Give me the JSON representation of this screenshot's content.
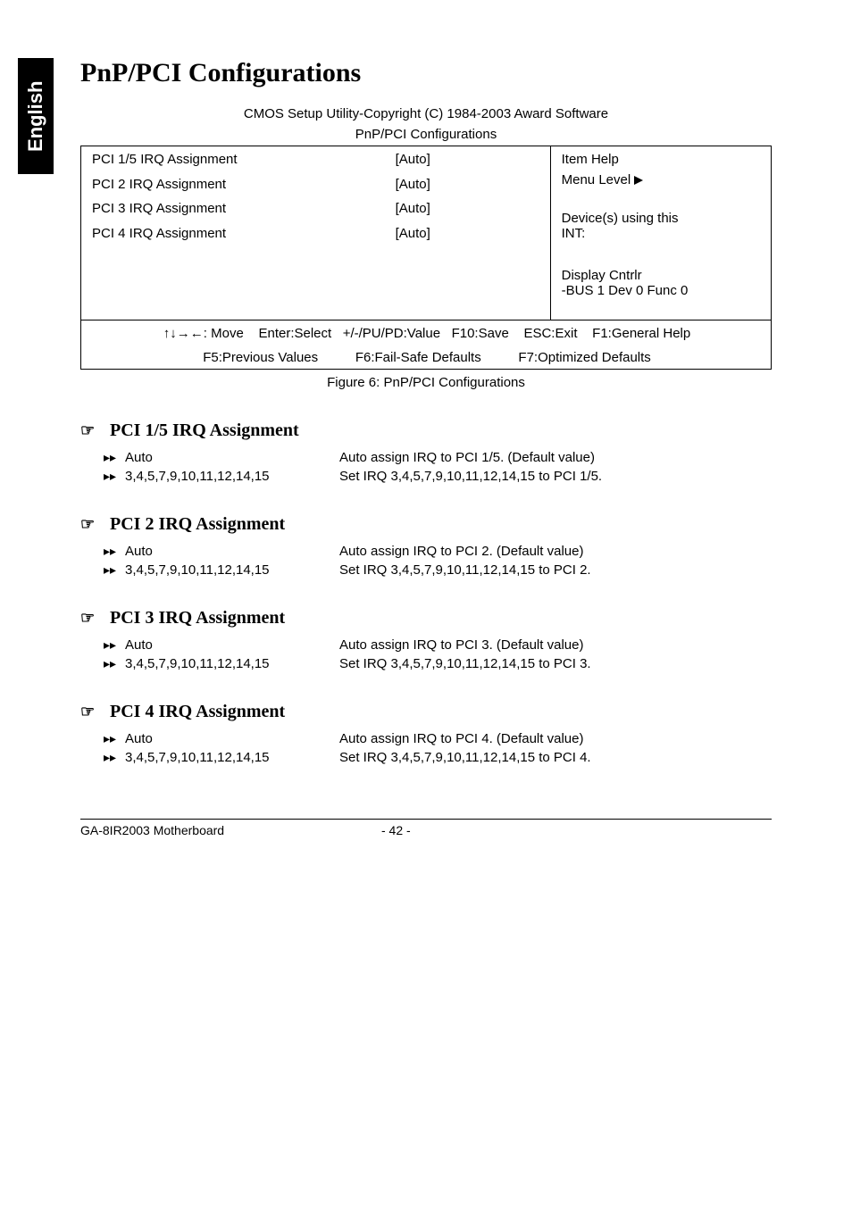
{
  "language_tab": "English",
  "page_title": "PnP/PCI Configurations",
  "bios": {
    "caption": "CMOS Setup Utility-Copyright (C) 1984-2003 Award Software",
    "subcaption": "PnP/PCI Configurations",
    "rows": [
      {
        "label": "PCI 1/5 IRQ Assignment",
        "value": "[Auto]"
      },
      {
        "label": "PCI 2 IRQ Assignment",
        "value": "[Auto]"
      },
      {
        "label": "PCI 3 IRQ Assignment",
        "value": "[Auto]"
      },
      {
        "label": "PCI 4 IRQ Assignment",
        "value": "[Auto]"
      }
    ],
    "help": {
      "title": "Item Help",
      "menu_level": "Menu Level",
      "device_line1": "Device(s) using this",
      "device_line2": "INT:",
      "disp1": "Display Cntrlr",
      "disp2": "-BUS 1 Dev 0 Func 0"
    },
    "footer1_left": "↑↓→←: Move",
    "footer1_a": "Enter:Select",
    "footer1_b": "+/-/PU/PD:Value",
    "footer1_c": "F10:Save",
    "footer1_d": "ESC:Exit",
    "footer1_e": "F1:General Help",
    "footer2_a": "F5:Previous Values",
    "footer2_b": "F6:Fail-Safe Defaults",
    "footer2_c": "F7:Optimized Defaults"
  },
  "fig_caption": "Figure 6: PnP/PCI Configurations",
  "sections": [
    {
      "title": "PCI 1/5 IRQ Assignment",
      "opts": [
        {
          "label": "Auto",
          "desc": "Auto assign IRQ to PCI 1/5. (Default value)"
        },
        {
          "label": "3,4,5,7,9,10,11,12,14,15",
          "desc": "Set IRQ 3,4,5,7,9,10,11,12,14,15 to PCI 1/5."
        }
      ]
    },
    {
      "title": "PCI 2 IRQ Assignment",
      "opts": [
        {
          "label": "Auto",
          "desc": "Auto assign IRQ to PCI 2. (Default value)"
        },
        {
          "label": "3,4,5,7,9,10,11,12,14,15",
          "desc": "Set IRQ 3,4,5,7,9,10,11,12,14,15 to PCI 2."
        }
      ]
    },
    {
      "title": "PCI 3 IRQ Assignment",
      "opts": [
        {
          "label": "Auto",
          "desc": "Auto assign IRQ to PCI 3. (Default value)"
        },
        {
          "label": "3,4,5,7,9,10,11,12,14,15",
          "desc": "Set IRQ 3,4,5,7,9,10,11,12,14,15 to PCI 3."
        }
      ]
    },
    {
      "title": "PCI 4 IRQ Assignment",
      "opts": [
        {
          "label": "Auto",
          "desc": "Auto assign IRQ to PCI 4. (Default value)"
        },
        {
          "label": "3,4,5,7,9,10,11,12,14,15",
          "desc": "Set IRQ 3,4,5,7,9,10,11,12,14,15 to PCI 4."
        }
      ]
    }
  ],
  "footer": {
    "board": "GA-8IR2003 Motherboard",
    "page": "- 42 -"
  }
}
